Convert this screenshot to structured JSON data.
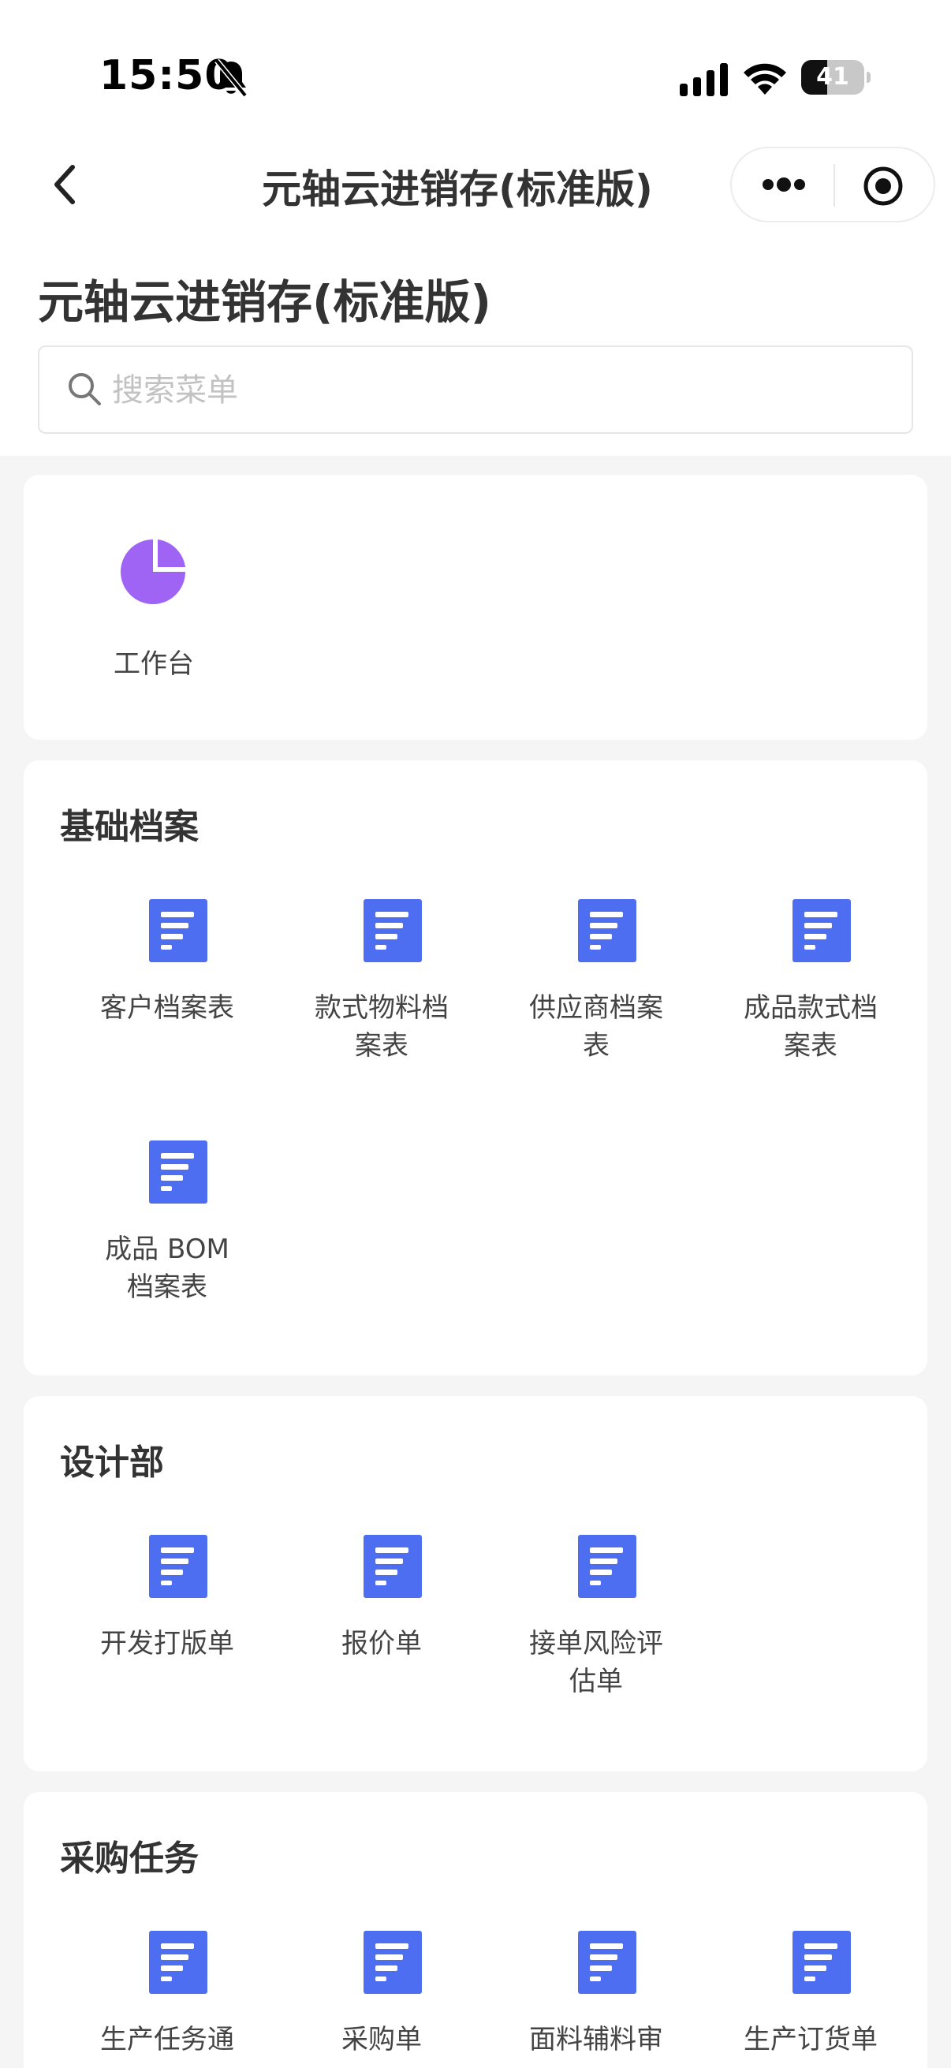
{
  "status_bar": {
    "time": "15:50",
    "battery": "41",
    "battery_level": 0.41
  },
  "nav": {
    "title": "元轴云进销存(标准版)"
  },
  "page_heading": "元轴云进销存(标准版)",
  "search": {
    "placeholder": "搜索菜单"
  },
  "workspace": {
    "label": "工作台",
    "icon": "pie-chart-icon",
    "color": "#a064f5"
  },
  "icon_color": "#4e6ef2",
  "sections": [
    {
      "title": "基础档案",
      "items": [
        "客户档案表",
        "款式物料档案表",
        "供应商档案表",
        "成品款式档案表",
        "成品 BOM 档案表"
      ]
    },
    {
      "title": "设计部",
      "items": [
        "开发打版单",
        "报价单",
        "接单风险评估单"
      ]
    },
    {
      "title": "采购任务",
      "items": [
        "生产任务通",
        "采购单",
        "面料辅料审",
        "生产订货单"
      ]
    }
  ]
}
